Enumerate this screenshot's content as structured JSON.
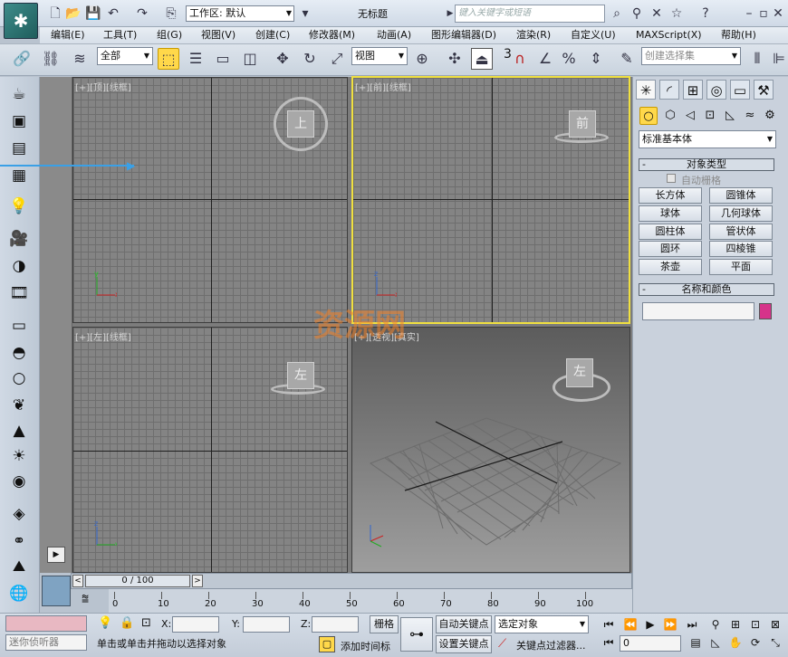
{
  "title_bar": {
    "workspace_label": "工作区: 默认",
    "document_title": "无标题",
    "search_placeholder": "键入关键字或短语"
  },
  "menu": [
    "编辑(E)",
    "工具(T)",
    "组(G)",
    "视图(V)",
    "创建(C)",
    "修改器(M)",
    "动画(A)",
    "图形编辑器(D)",
    "渲染(R)",
    "自定义(U)",
    "MAXScript(X)",
    "帮助(H)"
  ],
  "toolbar": {
    "selection_filter": "全部",
    "reference_coord": "视图",
    "named_selection_placeholder": "创建选择集",
    "snap_label": "3"
  },
  "viewports": [
    {
      "label": "[+][顶][线框]",
      "cube": "上",
      "active": false
    },
    {
      "label": "[+][前][线框]",
      "cube": "前",
      "active": true
    },
    {
      "label": "[+][左][线框]",
      "cube": "左",
      "active": false
    },
    {
      "label": "[+][透视][真实]",
      "cube": "左",
      "active": false
    }
  ],
  "command_panel": {
    "category_dropdown": "标准基本体",
    "object_type_title": "对象类型",
    "autogrid_label": "自动栅格",
    "objects": [
      "长方体",
      "圆锥体",
      "球体",
      "几何球体",
      "圆柱体",
      "管状体",
      "圆环",
      "四棱锥",
      "茶壶",
      "平面"
    ],
    "name_color_title": "名称和颜色",
    "object_color": "#d6338a"
  },
  "timeline": {
    "frame_counter": "0 / 100",
    "ticks": [
      "0",
      "10",
      "20",
      "30",
      "40",
      "50",
      "60",
      "70",
      "80",
      "90",
      "100"
    ]
  },
  "status": {
    "maxscript_mini": "迷你侦听器",
    "prompt": "单击或单击并拖动以选择对象",
    "x_label": "X:",
    "y_label": "Y:",
    "z_label": "Z:",
    "grid_label": "栅格",
    "add_time_tag": "添加时间标",
    "auto_key": "自动关键点",
    "set_key": "设置关键点",
    "selected_dropdown": "选定对象",
    "key_filters": "关键点过滤器...",
    "current_frame": "0"
  },
  "watermark": "资源网"
}
